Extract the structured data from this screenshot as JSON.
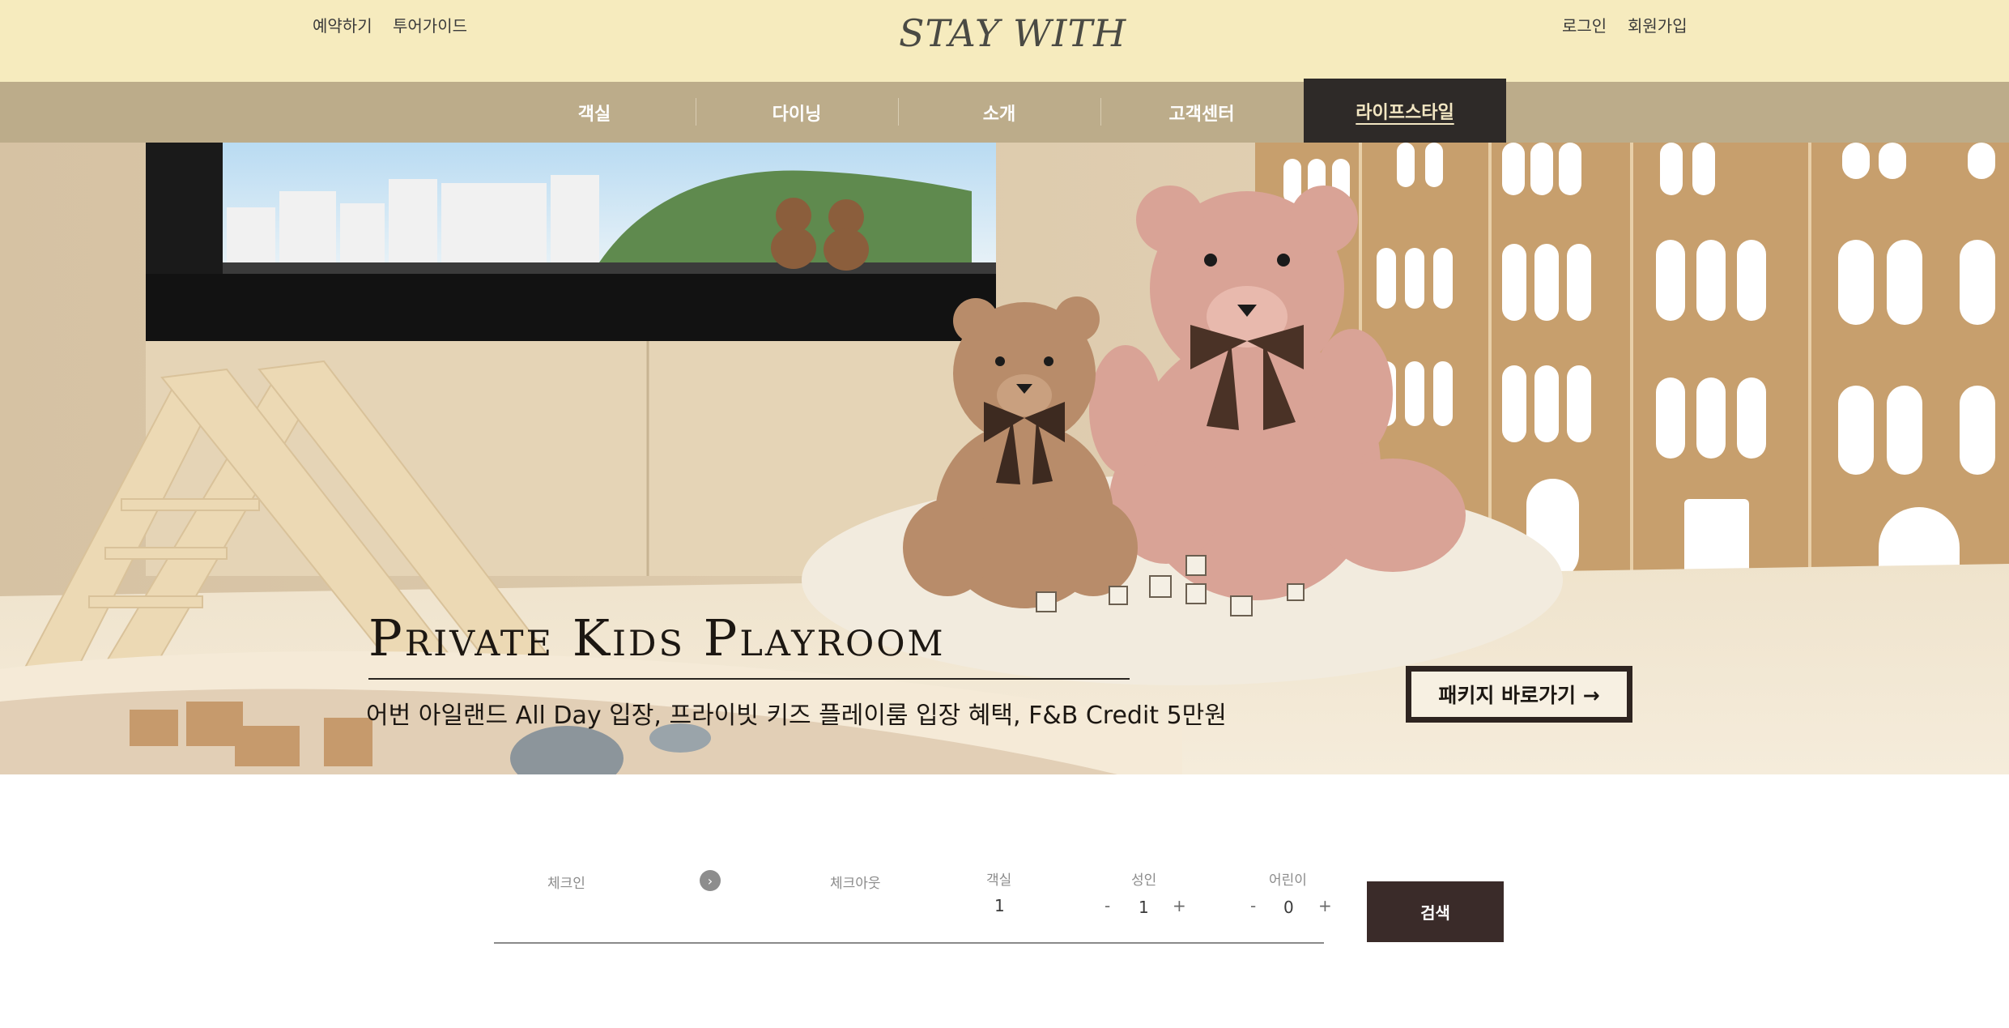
{
  "header": {
    "util_left": [
      "예약하기",
      "투어가이드"
    ],
    "logo": "STAY WITH",
    "util_right": [
      "로그인",
      "회원가입"
    ]
  },
  "nav": {
    "items": [
      "객실",
      "다이닝",
      "소개",
      "고객센터",
      "라이프스타일"
    ],
    "active": "라이프스타일"
  },
  "hero": {
    "title": "Private Kids Playroom",
    "subtitle": "어번 아일랜드 All Day 입장, 프라이빗 키즈 플레이룸 입장 혜택, F&B Credit 5만원",
    "cta": "패키지 바로가기 →"
  },
  "booking": {
    "checkin_label": "체크인",
    "checkout_label": "체크아웃",
    "rooms_label": "객실",
    "rooms_value": "1",
    "adults_label": "성인",
    "adults_value": "1",
    "children_label": "어린이",
    "children_value": "0",
    "minus": "-",
    "plus": "+",
    "arrow_icon": "chevron-right-icon",
    "search_label": "검색"
  },
  "colors": {
    "topbar": "#f6ebbe",
    "nav": "#bcac8a",
    "nav_active": "#2e2a28",
    "search_button": "#3a2b29"
  }
}
